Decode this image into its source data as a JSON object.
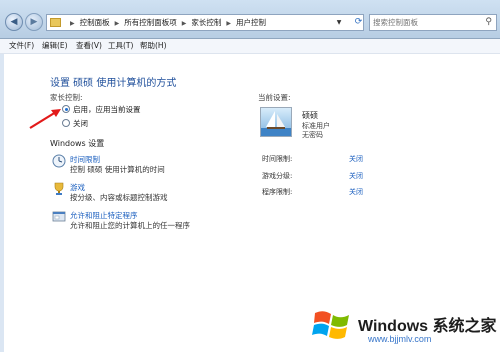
{
  "address_bar": {
    "breadcrumbs": [
      "控制面板",
      "所有控制面板项",
      "家长控制",
      "用户控制"
    ],
    "search_placeholder": "搜索控制面板"
  },
  "menu": {
    "file": "文件(F)",
    "edit": "编辑(E)",
    "view": "查看(V)",
    "tools": "工具(T)",
    "help": "帮助(H)"
  },
  "main": {
    "title": "设置 硕硕 使用计算机的方式",
    "parental_label": "家长控制:",
    "option_on": "启用，应用当前设置",
    "option_off": "关闭",
    "selected_option": "on",
    "windows_settings": "Windows 设置",
    "items": [
      {
        "icon": "clock-icon",
        "link": "时间限制",
        "desc": "控制 硕硕 使用计算机的时间"
      },
      {
        "icon": "trophy-icon",
        "link": "游戏",
        "desc": "按分级、内容或标题控制游戏"
      },
      {
        "icon": "program-icon",
        "link": "允许和阻止特定程序",
        "desc": "允许和阻止您的计算机上的任一程序"
      }
    ]
  },
  "current_settings": {
    "label": "当前设置:",
    "user_name": "硕硕",
    "user_role": "标准用户",
    "user_password": "无密码",
    "rows": [
      {
        "label": "时间限制:",
        "value": "关闭"
      },
      {
        "label": "游戏分级:",
        "value": "关闭"
      },
      {
        "label": "程序限制:",
        "value": "关闭"
      }
    ]
  },
  "watermark": {
    "brand": "Windows 系统之家",
    "url": "www.bjjmlv.com"
  },
  "colors": {
    "link": "#1b5fbf",
    "title": "#1f4f9b",
    "arrow": "#e21a1a"
  }
}
